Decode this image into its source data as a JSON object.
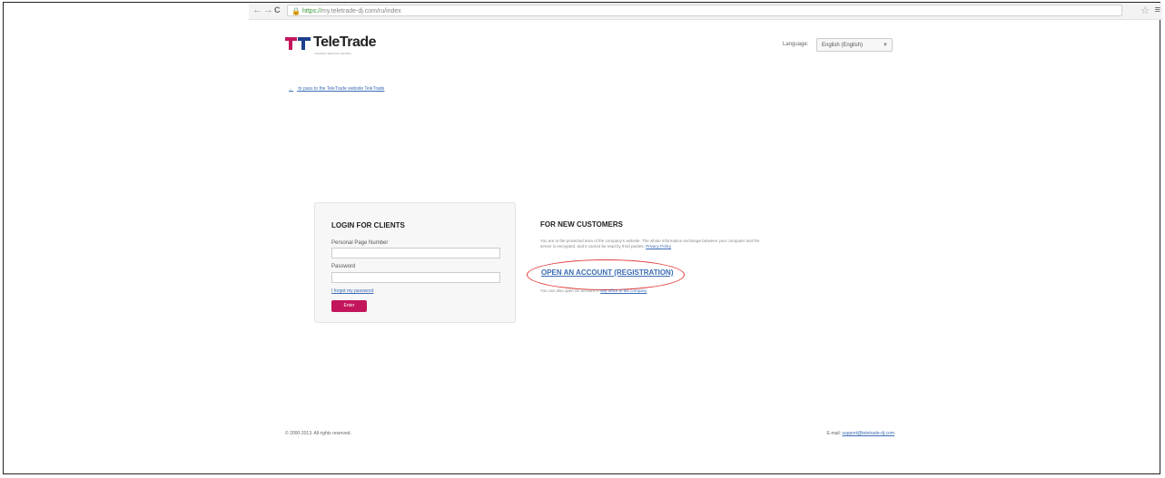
{
  "browser": {
    "back_glyph": "←",
    "forward_glyph": "→",
    "reload_glyph": "C",
    "lock_glyph": "🔒",
    "url_protocol": "https://",
    "url_rest": "my.teletrade-dj.com/ru/index",
    "star_glyph": "☆",
    "menu_glyph": "≡"
  },
  "header": {
    "logo_text": "TeleTrade",
    "logo_tagline": "TRADING SERVICE CENTER",
    "language_label": "Language:",
    "language_value": "English (English)",
    "language_arrow": "▼"
  },
  "nav": {
    "back_arrow": "←",
    "back_link": "to pass to the TeleTrade website TeleTrade"
  },
  "login": {
    "title": "LOGIN FOR CLIENTS",
    "pp_label": "Personal Page Number",
    "password_label": "Password",
    "forgot_link": "I forgot my password",
    "enter_button": "Enter"
  },
  "customers": {
    "title": "FOR NEW CUSTOMERS",
    "text": "You are in the protected area of the company's website. The whole information exchange between your computer and the server is encrypted, and it cannot be read by third parties.",
    "privacy_link": "Privacy Policy",
    "open_account": "OPEN AN ACCOUNT (REGISTRATION)",
    "office_text": "You can also open an account in",
    "office_link": "any office of the company"
  },
  "footer": {
    "copyright": "© 2000-2013. All rights reserved.",
    "email_label": "E-mail:",
    "email_link": "support@teletrade-dj.com"
  },
  "colors": {
    "accent": "#c3155a",
    "link": "#3b6cb5",
    "highlight_circle": "#e03a3a"
  }
}
